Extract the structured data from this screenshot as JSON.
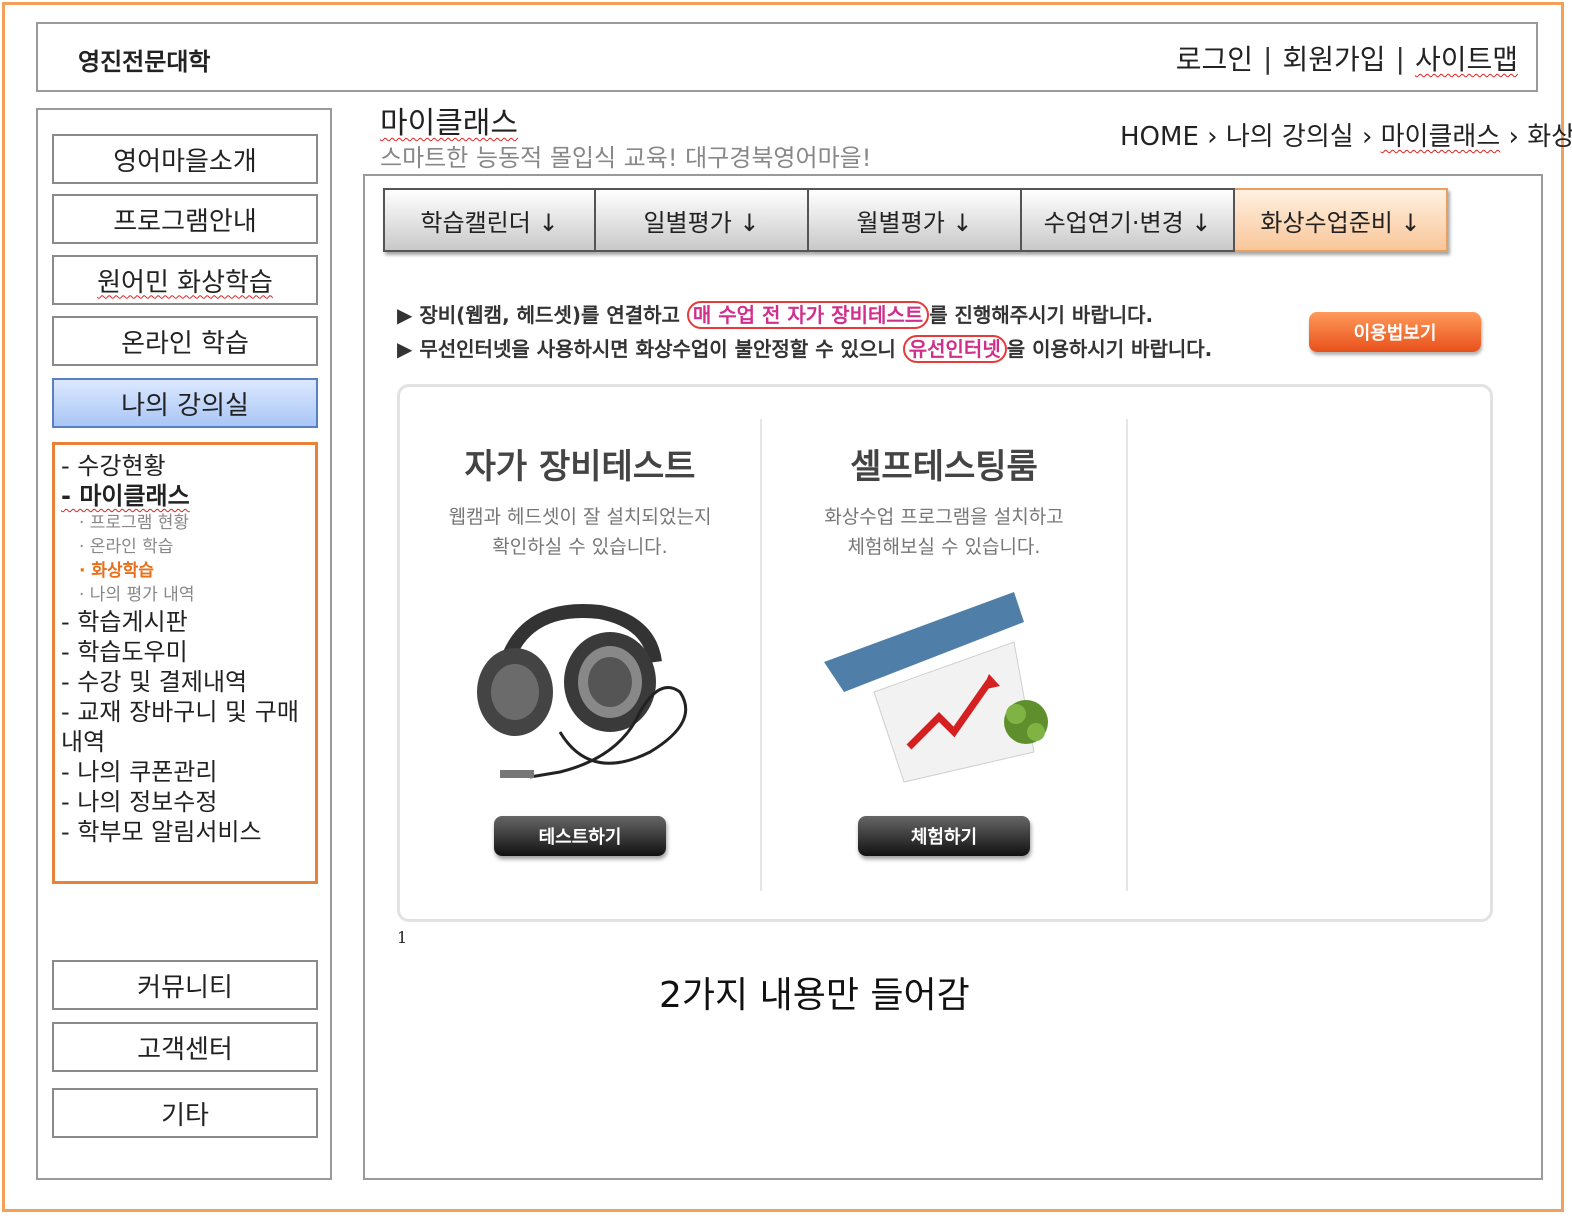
{
  "header": {
    "site_title": "영진전문대학",
    "login": "로그인",
    "join": "회원가입",
    "sitemap": "사이트맵",
    "separator": "|"
  },
  "sidebar": {
    "top_items": [
      "영어마을소개",
      "프로그램안내",
      "원어민 화상학습",
      "온라인 학습",
      "나의 강의실"
    ],
    "submenu": {
      "items": [
        "- 수강현황",
        "- 마이클래스",
        "- 학습게시판",
        "- 학습도우미",
        "- 수강 및 결제내역",
        "- 교재 장바구니 및 구매내역",
        "- 나의 쿠폰관리",
        "- 나의 정보수정",
        "- 학부모 알림서비스"
      ],
      "sub_items": [
        "· 프로그램 현황",
        "· 온라인 학습",
        "· 화상학습",
        "· 나의 평가 내역"
      ]
    },
    "bottom_items": [
      "커뮤니티",
      "고객센터",
      "기타"
    ]
  },
  "page": {
    "title": "마이클래스",
    "subtitle": "스마트한 능동적 몰입식 교육! 대구경북영어마을!",
    "breadcrumb": [
      "HOME",
      "나의 강의실",
      "마이클래스",
      "화상"
    ],
    "breadcrumb_sep": "›"
  },
  "tabs": [
    "학습캘린더 ↓",
    "일별평가 ↓",
    "월별평가 ↓",
    "수업연기·변경 ↓",
    "화상수업준비 ↓"
  ],
  "notice": {
    "line1_a": "▶ 장비(웹캠, 헤드셋)를 연결하고 ",
    "line1_hl": "매 수업 전 자가 장비테스트",
    "line1_b": "를 진행해주시기 바랍니다.",
    "line2_a": "▶ 무선인터넷을 사용하시면 화상수업이 불안정할 수 있으니 ",
    "line2_hl": "유선인터넷",
    "line2_b": "을 이용하시기 바랍니다.",
    "usage_button": "이용법보기"
  },
  "cards": [
    {
      "title": "자가 장비테스트",
      "desc": "웹캠과 헤드셋이 잘 설치되었는지\n확인하실 수 있습니다.",
      "button": "테스트하기",
      "icon": "headphones-icon"
    },
    {
      "title": "셀프테스팅룸",
      "desc": "화상수업 프로그램을 설치하고\n체험해보실 수 있습니다.",
      "button": "체험하기",
      "icon": "growth-chart-icon"
    }
  ],
  "page_number": "1",
  "memo": "2가지 내용만 들어감",
  "colors": {
    "accent": "#f5a05a",
    "active_tab": "#f9c69a",
    "active_menu": "#a9c6f5",
    "current_sub": "#e8701a"
  }
}
